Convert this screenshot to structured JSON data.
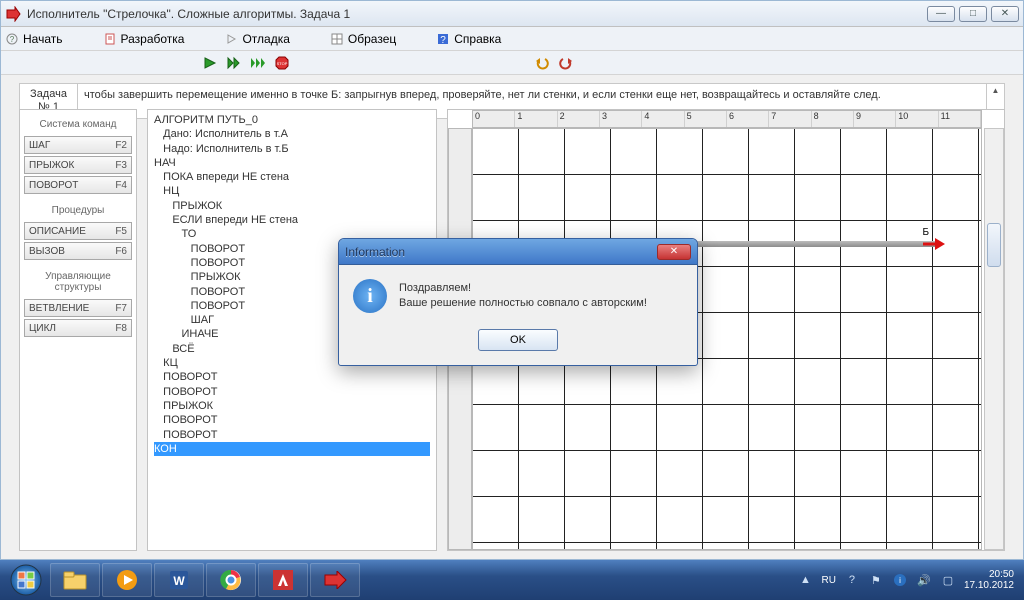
{
  "window": {
    "title": "Исполнитель \"Стрелочка\".  Сложные алгоритмы.  Задача 1"
  },
  "menu": {
    "start": "Начать",
    "develop": "Разработка",
    "debug": "Отладка",
    "sample": "Образец",
    "help": "Справка"
  },
  "task": {
    "label_line1": "Задача",
    "label_line2": "№ 1",
    "text": "чтобы завершить перемещение именно в точке Б: запрыгнув вперед, проверяйте, нет ли стенки, и если стенки еще нет, возвращайтесь и оставляйте след."
  },
  "side": {
    "group_cmds": "Система команд",
    "btn_step": "ШАГ",
    "key_step": "F2",
    "btn_jump": "ПРЫЖОК",
    "key_jump": "F3",
    "btn_turn": "ПОВОРОТ",
    "key_turn": "F4",
    "group_proc": "Процедуры",
    "btn_desc": "ОПИСАНИЕ",
    "key_desc": "F5",
    "btn_call": "ВЫЗОВ",
    "key_call": "F6",
    "group_ctrl": "Управляющие структуры",
    "btn_branch": "ВЕТВЛЕНИЕ",
    "key_branch": "F7",
    "btn_loop": "ЦИКЛ",
    "key_loop": "F8"
  },
  "code": [
    "АЛГОРИТМ ПУТЬ_0",
    "   Дано: Исполнитель в т.А",
    "   Надо: Исполнитель в т.Б",
    "НАЧ",
    "   ПОКА впереди НЕ стена",
    "   НЦ",
    "      ПРЫЖОК",
    "      ЕСЛИ впереди НЕ стена",
    "         ТО",
    "            ПОВОРОТ",
    "            ПОВОРОТ",
    "            ПРЫЖОК",
    "            ПОВОРОТ",
    "            ПОВОРОТ",
    "            ШАГ",
    "         ИНАЧЕ",
    "      ВСЁ",
    "   КЦ",
    "   ПОВОРОТ",
    "   ПОВОРОТ",
    "   ПРЫЖОК",
    "   ПОВОРОТ",
    "   ПОВОРОТ",
    "КОН"
  ],
  "code_selected_index": 23,
  "ruler_h": [
    "0",
    "1",
    "2",
    "3",
    "4",
    "5",
    "6",
    "7",
    "8",
    "9",
    "10",
    "11"
  ],
  "grid": {
    "point_b_label": "Б"
  },
  "dialog": {
    "title": "Information",
    "line1": "Поздравляем!",
    "line2": "Ваше решение полностью совпало с авторским!",
    "ok": "OK"
  },
  "taskbar": {
    "lang": "RU",
    "time": "20:50",
    "date": "17.10.2012"
  }
}
